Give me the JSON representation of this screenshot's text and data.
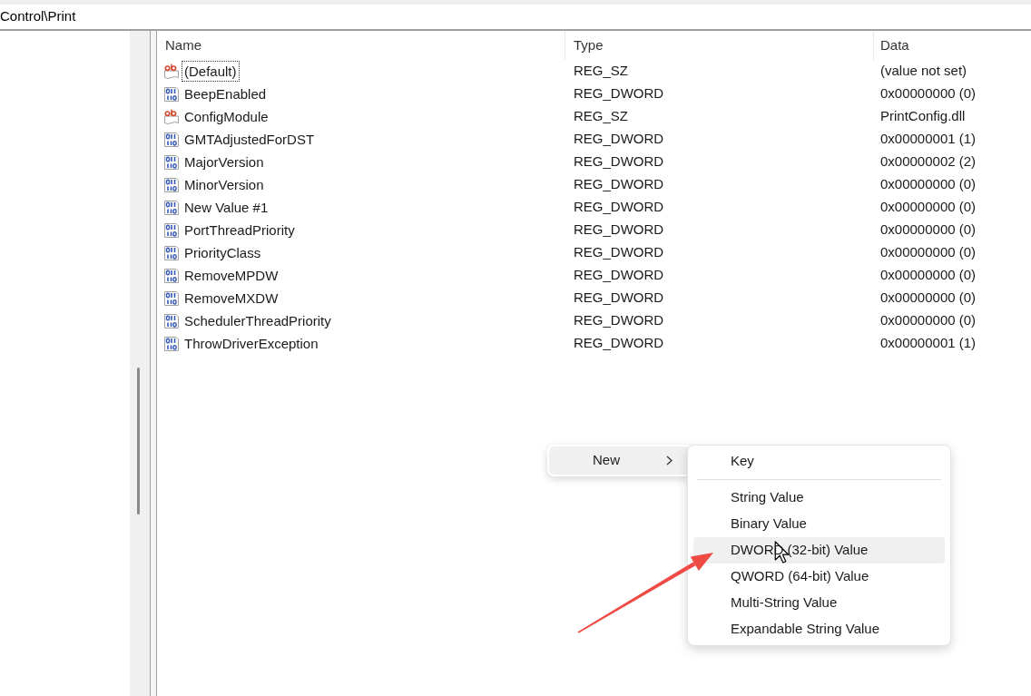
{
  "address_bar": {
    "path": "Control\\Print"
  },
  "values_table": {
    "columns": [
      "Name",
      "Type",
      "Data"
    ],
    "rows": [
      {
        "kind": "string",
        "name": "(Default)",
        "type": "REG_SZ",
        "data": "(value not set)",
        "focused": true
      },
      {
        "kind": "dword",
        "name": "BeepEnabled",
        "type": "REG_DWORD",
        "data": "0x00000000 (0)",
        "focused": false
      },
      {
        "kind": "string",
        "name": "ConfigModule",
        "type": "REG_SZ",
        "data": "PrintConfig.dll",
        "focused": false
      },
      {
        "kind": "dword",
        "name": "GMTAdjustedForDST",
        "type": "REG_DWORD",
        "data": "0x00000001 (1)",
        "focused": false
      },
      {
        "kind": "dword",
        "name": "MajorVersion",
        "type": "REG_DWORD",
        "data": "0x00000002 (2)",
        "focused": false
      },
      {
        "kind": "dword",
        "name": "MinorVersion",
        "type": "REG_DWORD",
        "data": "0x00000000 (0)",
        "focused": false
      },
      {
        "kind": "dword",
        "name": "New Value #1",
        "type": "REG_DWORD",
        "data": "0x00000000 (0)",
        "focused": false
      },
      {
        "kind": "dword",
        "name": "PortThreadPriority",
        "type": "REG_DWORD",
        "data": "0x00000000 (0)",
        "focused": false
      },
      {
        "kind": "dword",
        "name": "PriorityClass",
        "type": "REG_DWORD",
        "data": "0x00000000 (0)",
        "focused": false
      },
      {
        "kind": "dword",
        "name": "RemoveMPDW",
        "type": "REG_DWORD",
        "data": "0x00000000 (0)",
        "focused": false
      },
      {
        "kind": "dword",
        "name": "RemoveMXDW",
        "type": "REG_DWORD",
        "data": "0x00000000 (0)",
        "focused": false
      },
      {
        "kind": "dword",
        "name": "SchedulerThreadPriority",
        "type": "REG_DWORD",
        "data": "0x00000000 (0)",
        "focused": false
      },
      {
        "kind": "dword",
        "name": "ThrowDriverException",
        "type": "REG_DWORD",
        "data": "0x00000001 (1)",
        "focused": false
      }
    ]
  },
  "context_menu": {
    "items": [
      {
        "label": "New",
        "selected": true,
        "submenu": {
          "groups": [
            {
              "items": [
                {
                  "label": "Key",
                  "selected": false
                }
              ]
            },
            {
              "items": [
                {
                  "label": "String Value",
                  "selected": false
                },
                {
                  "label": "Binary Value",
                  "selected": false
                },
                {
                  "label": "DWORD (32-bit) Value",
                  "selected": true
                },
                {
                  "label": "QWORD (64-bit) Value",
                  "selected": false
                },
                {
                  "label": "Multi-String Value",
                  "selected": false
                },
                {
                  "label": "Expandable String Value",
                  "selected": false
                }
              ]
            }
          ]
        }
      }
    ]
  }
}
